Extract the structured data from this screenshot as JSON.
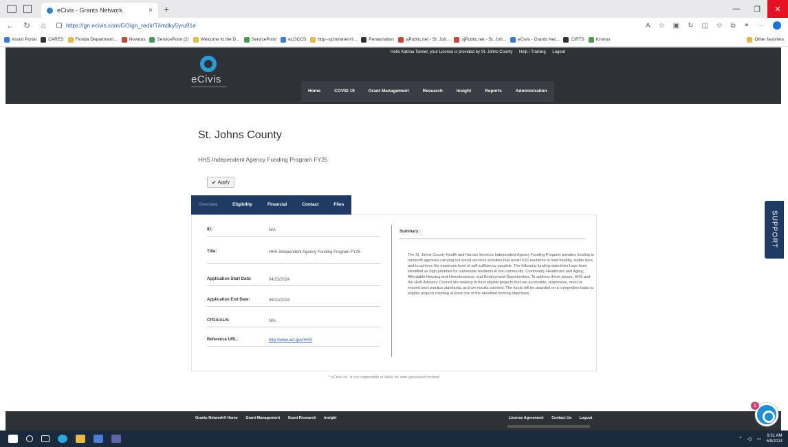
{
  "browser": {
    "tab_title": "eCivis - Grants Network",
    "tab_close": "×",
    "new_tab": "+",
    "url": "https://gn.ecivis.com/GO/gn_redir/T/imdky5yru91e",
    "favorites": [
      "Assist Portal",
      "CARES",
      "Florida Department...",
      "Novatus",
      "ServicePoint (2)",
      "Welcome to the D...",
      "ServicePoint",
      "eLOCCS",
      "http--sjcintranet-H...",
      "Pentamation",
      "sjPublic.net - St. Joh...",
      "sjPublic.net - St. Joh...",
      "eCivis - Grants Net...",
      "CIRTS",
      "Kronos"
    ],
    "other_favorites": "Other favorites"
  },
  "header": {
    "greeting": "Hello Katrina Tanner, your License is provided by St. Johns County",
    "help_link": "Help / Training",
    "logout_link": "Logout",
    "logo_text": "eCivis",
    "nav": [
      "Home",
      "COVID 19",
      "Grant Management",
      "Research",
      "Insight",
      "Reports",
      "Administration"
    ]
  },
  "page": {
    "title": "St. Johns County",
    "program_name": "HHS Independent Agency Funding Program FY25",
    "apply_label": "Apply",
    "tabs": [
      "Overview",
      "Eligibility",
      "Financial",
      "Contact",
      "Files"
    ],
    "active_tab": "Overview"
  },
  "details": [
    {
      "label": "ID:",
      "value": "N/A"
    },
    {
      "label": "Title:",
      "value": "HHS Independent Agency Funding Program FY25"
    },
    {
      "label": "Application Start Date:",
      "value": "04/22/2024"
    },
    {
      "label": "Application End Date:",
      "value": "05/31/2024"
    },
    {
      "label": "CFDA/ALN:",
      "value": "N/A"
    },
    {
      "label": "Reference URL:",
      "value": "http://www.acf.gov/HHS"
    }
  ],
  "summary": {
    "label": "Summary:",
    "text": "The St. Johns County Health and Human Services Independent Agency Funding Program provides funding to nonprofit agencies carrying out social services activities that assist SJC residents to lead healthy, stable lives, and to achieve the maximum level of self-sufficiency possible. The following funding objectives have been identified as high priorities for vulnerable residents in the community: Community Healthcare and Aging; Affordable Housing and Homelessness; and Employment Opportunities. To address these issues, HHS and the HHS Advisory Council are seeking to fund eligible projects that are accessible, responsive, meet or exceed best practice standards, and are results oriented. The funds will be awarded on a competitive basis to eligible projects meeting at least one of the identified funding objectives."
  },
  "disclaimer": "* eCivis Inc. is not responsible or liable for user-generated content.",
  "support_label": "SUPPORT",
  "footer": {
    "left_links": [
      "Grants Network® Home",
      "Grant Management",
      "Grant Research",
      "Insight"
    ],
    "right_links": [
      "License Agreement",
      "Contact Us",
      "Logout"
    ]
  },
  "chat_badge": "1",
  "taskbar": {
    "time": "9:31 AM",
    "date": "5/9/2024"
  },
  "colors": {
    "header_bg": "#2e3136",
    "tab_bg": "#1f3b63",
    "accent": "#2a9bd4"
  }
}
